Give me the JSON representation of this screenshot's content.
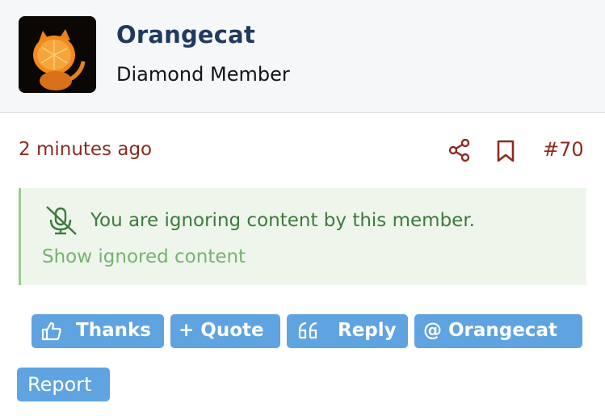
{
  "author": {
    "username": "Orangecat",
    "rank": "Diamond Member",
    "avatar_icon": "orange-cat-avatar"
  },
  "post": {
    "time": "2 minutes ago",
    "number": "#70",
    "share_icon": "share-icon",
    "bookmark_icon": "bookmark-icon"
  },
  "ignored_notice": {
    "icon": "mic-muted-icon",
    "message": "You are ignoring content by this member.",
    "show_link": "Show ignored content"
  },
  "actions": {
    "thanks_label": "Thanks",
    "quote_label": "+ Quote",
    "reply_label": "Reply",
    "mention_label": "@  Orangecat",
    "report_label": "Report"
  },
  "colors": {
    "accent_red": "#8a2c20",
    "username_blue": "#1f3a5f",
    "button_blue": "#5fa3e0",
    "notice_bg": "#eef6ec",
    "notice_text": "#3c7a3a",
    "notice_link": "#76b36f"
  }
}
